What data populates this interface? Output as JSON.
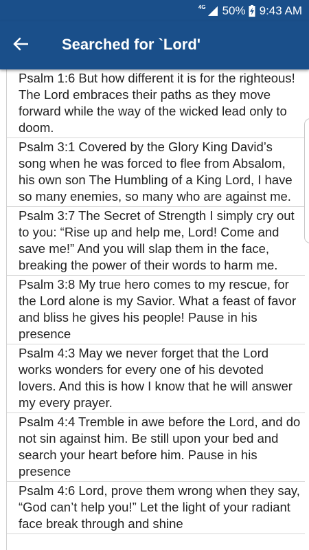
{
  "status_bar": {
    "network": "4G",
    "battery": "50%",
    "time": "9:43 AM",
    "signal_icon": "cell-signal-icon",
    "battery_icon": "battery-charging-icon"
  },
  "app_bar": {
    "title": "Searched for `Lord'",
    "back_icon": "arrow-left-icon",
    "background_color": "#1a4f8a"
  },
  "results": [
    "Psalm 1:6 But how different it is for the righteous! The Lord embraces their paths as they move forward while the way of the wicked lead only to doom.",
    "Psalm 3:1 Covered by the Glory King David’s song when he was forced to flee from Absalom, his own son The Humbling of a King Lord, I have so many enemies, so many who are against me.",
    "Psalm 3:7 The Secret of Strength I simply cry out to you: “Rise up and help me, Lord! Come and save me!” And you will slap them in the face, breaking the power of their words to harm me.",
    "Psalm 3:8 My true hero comes to my rescue, for the Lord alone is my Savior. What a feast of favor and bliss he gives his people! Pause in his presence",
    "Psalm 4:3 May we never forget that the Lord works wonders for every one of his devoted lovers. And this is how I know that he will answer my every prayer.",
    "Psalm 4:4 Tremble in awe before the Lord, and do not sin against him. Be still upon your bed and search your heart before him. Pause in his presence",
    "Psalm 4:6 Lord, prove them wrong when they say, “God can’t help you!” Let the light of your radiant face break through and shine"
  ]
}
